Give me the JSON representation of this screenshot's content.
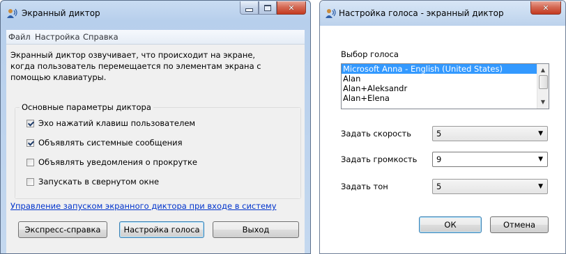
{
  "main_window": {
    "title": "Экранный диктор",
    "menu": [
      "Файл",
      "Настройка",
      "Справка"
    ],
    "description": "Экранный диктор озвучивает, что происходит на экране, когда пользователь перемещается по элементам экрана с помощью клавиатуры.",
    "group_title": "Основные параметры диктора",
    "options": [
      {
        "label": "Эхо нажатий клавиш пользователем",
        "checked": true
      },
      {
        "label": "Объявлять системные сообщения",
        "checked": true
      },
      {
        "label": "Объявлять уведомления о прокрутке",
        "checked": false
      },
      {
        "label": "Запускать в свернутом окне",
        "checked": false
      }
    ],
    "link": "Управление запуском экранного диктора при входе в систему",
    "buttons": {
      "help": "Экспресс-справка",
      "voice": "Настройка голоса",
      "exit": "Выход"
    }
  },
  "voice_dialog": {
    "title": "Настройка голоса - экранный диктор",
    "voice_label": "Выбор голоса",
    "voices": [
      "Microsoft Anna - English (United States)",
      "Alan",
      "Alan+Aleksandr",
      "Alan+Elena"
    ],
    "selected_voice_index": 0,
    "speed_label": "Задать скорость",
    "speed_value": "5",
    "volume_label": "Задать громкость",
    "volume_value": "9",
    "pitch_label": "Задать тон",
    "pitch_value": "5",
    "ok": "ОК",
    "cancel": "Отмена"
  },
  "icons": [
    "narrator-icon",
    "minimize-icon",
    "maximize-icon",
    "close-icon",
    "dropdown-arrow-icon",
    "scroll-up-icon",
    "scroll-down-icon"
  ]
}
